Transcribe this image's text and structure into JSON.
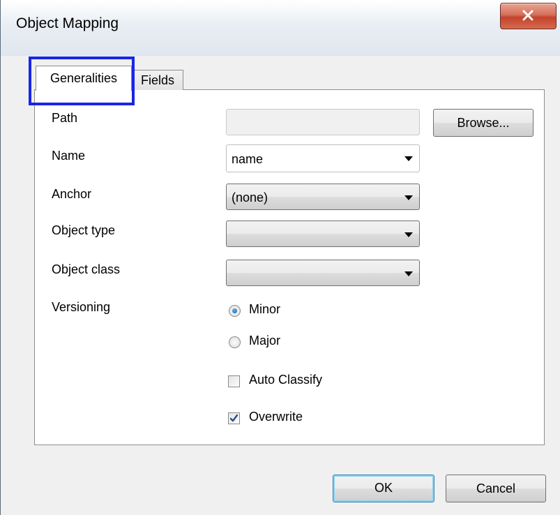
{
  "dialog": {
    "title": "Object Mapping",
    "close_glyph": "x",
    "close_icon": "close-icon"
  },
  "tabs": [
    {
      "label": "Generalities",
      "selected": true
    },
    {
      "label": "Fields",
      "selected": false
    }
  ],
  "form": {
    "path": {
      "label": "Path",
      "value": ""
    },
    "browse_label": "Browse...",
    "name": {
      "label": "Name",
      "value": "name"
    },
    "anchor": {
      "label": "Anchor",
      "value": "(none)"
    },
    "object_type": {
      "label": "Object type",
      "value": ""
    },
    "object_class": {
      "label": "Object class",
      "value": ""
    },
    "versioning": {
      "label": "Versioning",
      "options": [
        {
          "label": "Minor",
          "checked": true
        },
        {
          "label": "Major",
          "checked": false
        }
      ]
    },
    "auto_classify": {
      "label": "Auto Classify",
      "checked": false
    },
    "overwrite": {
      "label": "Overwrite",
      "checked": true
    }
  },
  "footer": {
    "ok_label": "OK",
    "cancel_label": "Cancel"
  },
  "colors": {
    "focus_highlight": "#1a25e6",
    "close_button": "#c4432c"
  }
}
